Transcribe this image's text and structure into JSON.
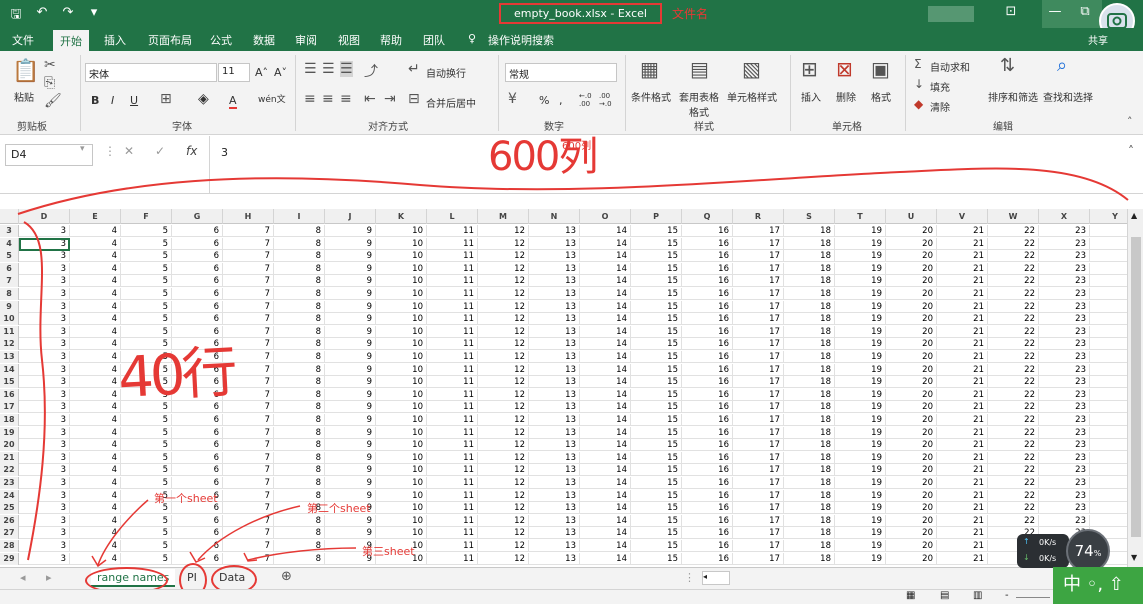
{
  "titlebar": {
    "title": "empty_book.xlsx  -  Excel",
    "filename_note": "文件名",
    "restore_glyph": "⧉"
  },
  "tabs": [
    "文件",
    "开始",
    "插入",
    "页面布局",
    "公式",
    "数据",
    "审阅",
    "视图",
    "帮助",
    "团队",
    "操作说明搜索"
  ],
  "share_label": "共享",
  "ribbon": {
    "clipboard": {
      "paste": "粘贴",
      "label": "剪贴板"
    },
    "font": {
      "name": "宋体",
      "size": "11",
      "label": "字体",
      "bold": "B",
      "italic": "I",
      "underline": "U",
      "grow": "A˄",
      "shrink": "A˅",
      "color_a": "A",
      "wen": "wén文"
    },
    "alignment": {
      "wrap": "自动换行",
      "merge": "合并后居中",
      "label": "对齐方式"
    },
    "number": {
      "format": "常规",
      "label": "数字",
      "percent": "%",
      "comma": ",",
      "inc": "←.0 .00",
      "dec": ".00 →.0"
    },
    "styles": {
      "cond": "条件格式",
      "table": "套用表格格式",
      "cell": "单元格样式",
      "label": "样式"
    },
    "cells": {
      "insert": "插入",
      "delete": "删除",
      "format": "格式",
      "label": "单元格"
    },
    "editing": {
      "autosum": "自动求和",
      "fill": "填充",
      "clear": "清除",
      "sort": "排序和筛选",
      "find": "查找和选择",
      "label": "编辑"
    }
  },
  "formula_bar": {
    "name_box": "D4",
    "fx": "fx",
    "value": "3"
  },
  "columns": [
    "D",
    "E",
    "F",
    "G",
    "H",
    "I",
    "J",
    "K",
    "L",
    "M",
    "N",
    "O",
    "P",
    "Q",
    "R",
    "S",
    "T",
    "U",
    "V",
    "W",
    "X",
    "Y"
  ],
  "rows": [
    3,
    4,
    5,
    6,
    7,
    8,
    9,
    10,
    11,
    12,
    13,
    14,
    15,
    16,
    17,
    18,
    19,
    20,
    21,
    22,
    23,
    24,
    25,
    26,
    27,
    28,
    29
  ],
  "row_values": [
    "3",
    "4",
    "5",
    "6",
    "7",
    "8",
    "9",
    "10",
    "11",
    "12",
    "13",
    "14",
    "15",
    "16",
    "17",
    "18",
    "19",
    "20",
    "21",
    "22",
    "23"
  ],
  "sheets": [
    "range names",
    "PI",
    "Data"
  ],
  "annotations": {
    "cols_handwritten": "600列",
    "cols_small": "600列",
    "rows_handwritten": "40行",
    "sheet1": "第一个sheet",
    "sheet2": "第二个sheet",
    "sheet3": "第三sheet"
  },
  "tray": {
    "percent": "74",
    "percent_sign": "%",
    "net_up": "0K/s",
    "net_down": "0K/s",
    "ime": "中 ◦, ⇧"
  },
  "colors": {
    "excel_green": "#217346",
    "annotation_red": "#e53935"
  }
}
